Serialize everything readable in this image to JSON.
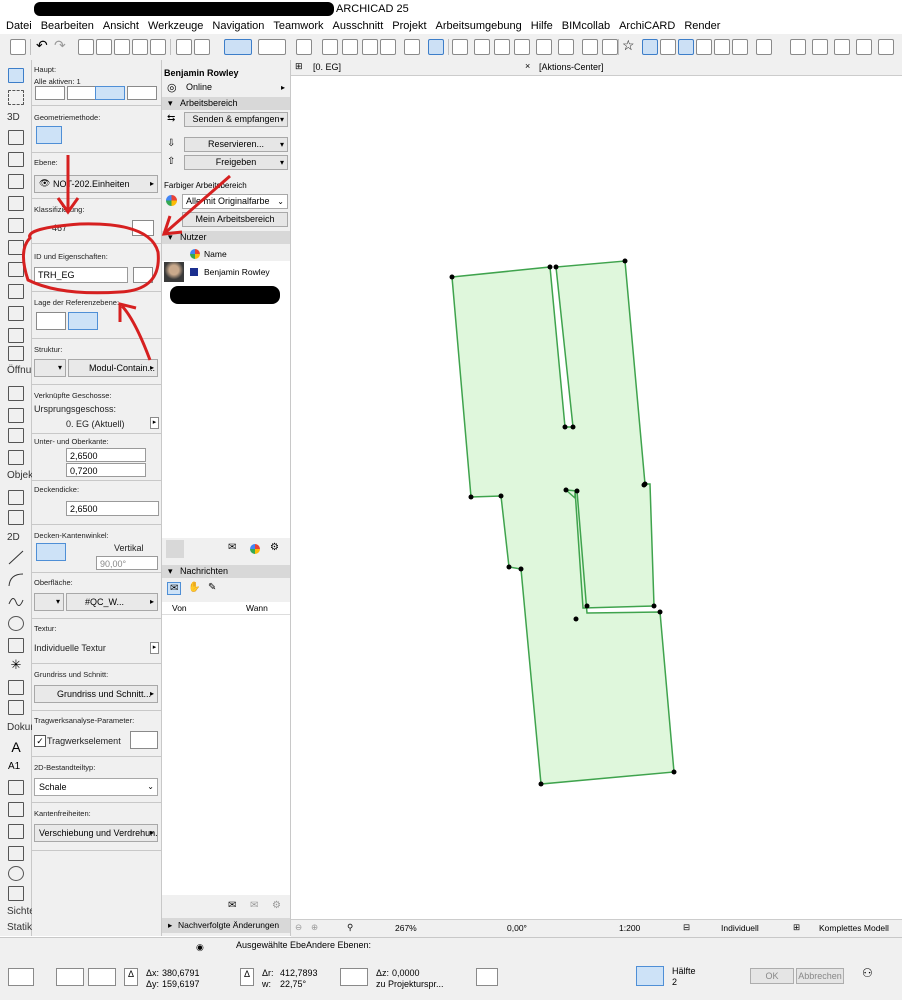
{
  "window": {
    "title": "ARCHICAD 25"
  },
  "menu": [
    "Datei",
    "Bearbeiten",
    "Ansicht",
    "Werkzeuge",
    "Navigation",
    "Teamwork",
    "Ausschnitt",
    "Projekt",
    "Arbeitsumgebung",
    "Hilfe",
    "BIMcollab",
    "ArchiCARD",
    "Render"
  ],
  "toolbox": {
    "sections": {
      "s3d": "3D",
      "openings": "Öffnu",
      "objects": "Objek",
      "s2d": "2D",
      "docu": "Dokur",
      "views": "Sichte",
      "static": "Statik"
    }
  },
  "infobox": {
    "main_label": "Haupt:",
    "all_active": "Alle aktiven: 1",
    "geometry_label": "Geometriemethode:",
    "layer_label": "Ebene:",
    "layer_value": "NOT-202.Einheiten",
    "classification_label": "Klassifizierung:",
    "classification_value": "467",
    "id_label": "ID und Eigenschaften:",
    "id_value": "TRH_EG",
    "ref_plane_label": "Lage der Referenzebene:",
    "structure_label": "Struktur:",
    "structure_value": "Modul-Contain...",
    "linked_stories_label": "Verknüpfte Geschosse:",
    "home_story_label": "Ursprungsgeschoss:",
    "home_story_value": "0. EG (Aktuell)",
    "top_bottom_label": "Unter- und Oberkante:",
    "top_value": "2,6500",
    "bottom_value": "0,7200",
    "thickness_label": "Deckendicke:",
    "thickness_value": "2,6500",
    "edge_angle_label": "Decken-Kantenwinkel:",
    "edge_angle_mode": "Vertikal",
    "edge_angle_value": "90,00°",
    "surface_label": "Oberfläche:",
    "surface_value": "#QC_W...",
    "texture_label": "Textur:",
    "texture_value": "Individuelle Textur",
    "floorplan_label": "Grundriss und Schnitt:",
    "floorplan_value": "Grundriss und Schnitt...",
    "structural_label": "Tragwerksanalyse-Parameter:",
    "structural_value": "Tragwerkselement",
    "element_type_label": "2D-Bestandteiltyp:",
    "element_type_value": "Schale",
    "edge_release_label": "Kantenfreiheiten:",
    "edge_release_value": "Verschiebung und Verdrehun..."
  },
  "teamwork": {
    "user": "Benjamin Rowley",
    "status": "Online",
    "workspace_header": "Arbeitsbereich",
    "send_receive": "Senden & empfangen",
    "reserve": "Reservieren...",
    "release": "Freigeben",
    "colored_label": "Farbiger Arbeitsbereich",
    "colored_value": "Alle mit Originalfarbe",
    "my_workspace": "Mein Arbeitsbereich",
    "users_header": "Nutzer",
    "name_col": "Name",
    "user_row": "Benjamin Rowley",
    "messages_header": "Nachrichten",
    "from_col": "Von",
    "when_col": "Wann",
    "changes_header": "Nachverfolgte Änderungen"
  },
  "tabs": {
    "floorplan": "[0. EG]",
    "action_center": "[Aktions-Center]"
  },
  "status": {
    "zoom": "267%",
    "angle": "0,00°",
    "scale": "1:200",
    "layer_combo": "Individuell",
    "model_view": "Komplettes Modell"
  },
  "coords": {
    "dx": "380,6791",
    "dy": "159,6197",
    "r": "412,7893",
    "angle": "22,75°",
    "z": "0,0000",
    "z_ref": "zu Projekturspr...",
    "selected_layer": "Ausgewählte Ebe",
    "other_layers": "Andere Ebenen:",
    "half": "Hälfte",
    "half_n": "2",
    "ok": "OK",
    "cancel": "Abbrechen",
    "lbl_dx": "Δx:",
    "lbl_dy": "Δy:",
    "lbl_r": "Δr:",
    "lbl_w": "w:",
    "lbl_z": "Δz:"
  },
  "colors": {
    "slab_fill": "#dff7dc",
    "slab_stroke": "#3fa34d",
    "annotation": "#d62020"
  }
}
